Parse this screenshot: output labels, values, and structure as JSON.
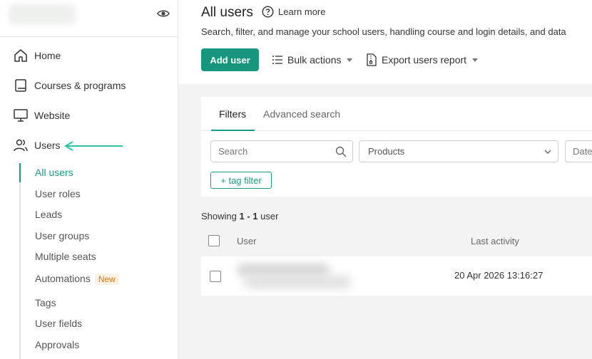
{
  "sidebar": {
    "nav": [
      {
        "label": "Home",
        "icon": "home-icon"
      },
      {
        "label": "Courses & programs",
        "icon": "book-icon"
      },
      {
        "label": "Website",
        "icon": "monitor-icon"
      },
      {
        "label": "Users",
        "icon": "users-icon"
      }
    ],
    "sub": [
      {
        "label": "All users",
        "active": true
      },
      {
        "label": "User roles"
      },
      {
        "label": "Leads"
      },
      {
        "label": "User groups"
      },
      {
        "label": "Multiple seats"
      },
      {
        "label": "Automations",
        "badge": "New"
      },
      {
        "label": "Tags"
      },
      {
        "label": "User fields"
      },
      {
        "label": "Approvals"
      }
    ]
  },
  "header": {
    "title": "All users",
    "learn_more": "Learn more",
    "subtitle": "Search, filter, and manage your school users, handling course and login details, and data",
    "add_user": "Add user",
    "bulk_actions": "Bulk actions",
    "export": "Export users report"
  },
  "filters": {
    "tabs": [
      "Filters",
      "Advanced search"
    ],
    "search_placeholder": "Search",
    "products": "Products",
    "date_placeholder": "Date",
    "tag_filter": "+ tag filter"
  },
  "results": {
    "showing_prefix": "Showing ",
    "range": "1 - 1",
    "suffix": " user"
  },
  "table": {
    "columns": [
      "User",
      "Last activity"
    ],
    "rows": [
      {
        "last_activity": "20 Apr 2026 13:16:27"
      }
    ]
  },
  "colors": {
    "accent": "#1a9c84",
    "primary_button": "#17957d",
    "badge_text": "#d97316"
  }
}
